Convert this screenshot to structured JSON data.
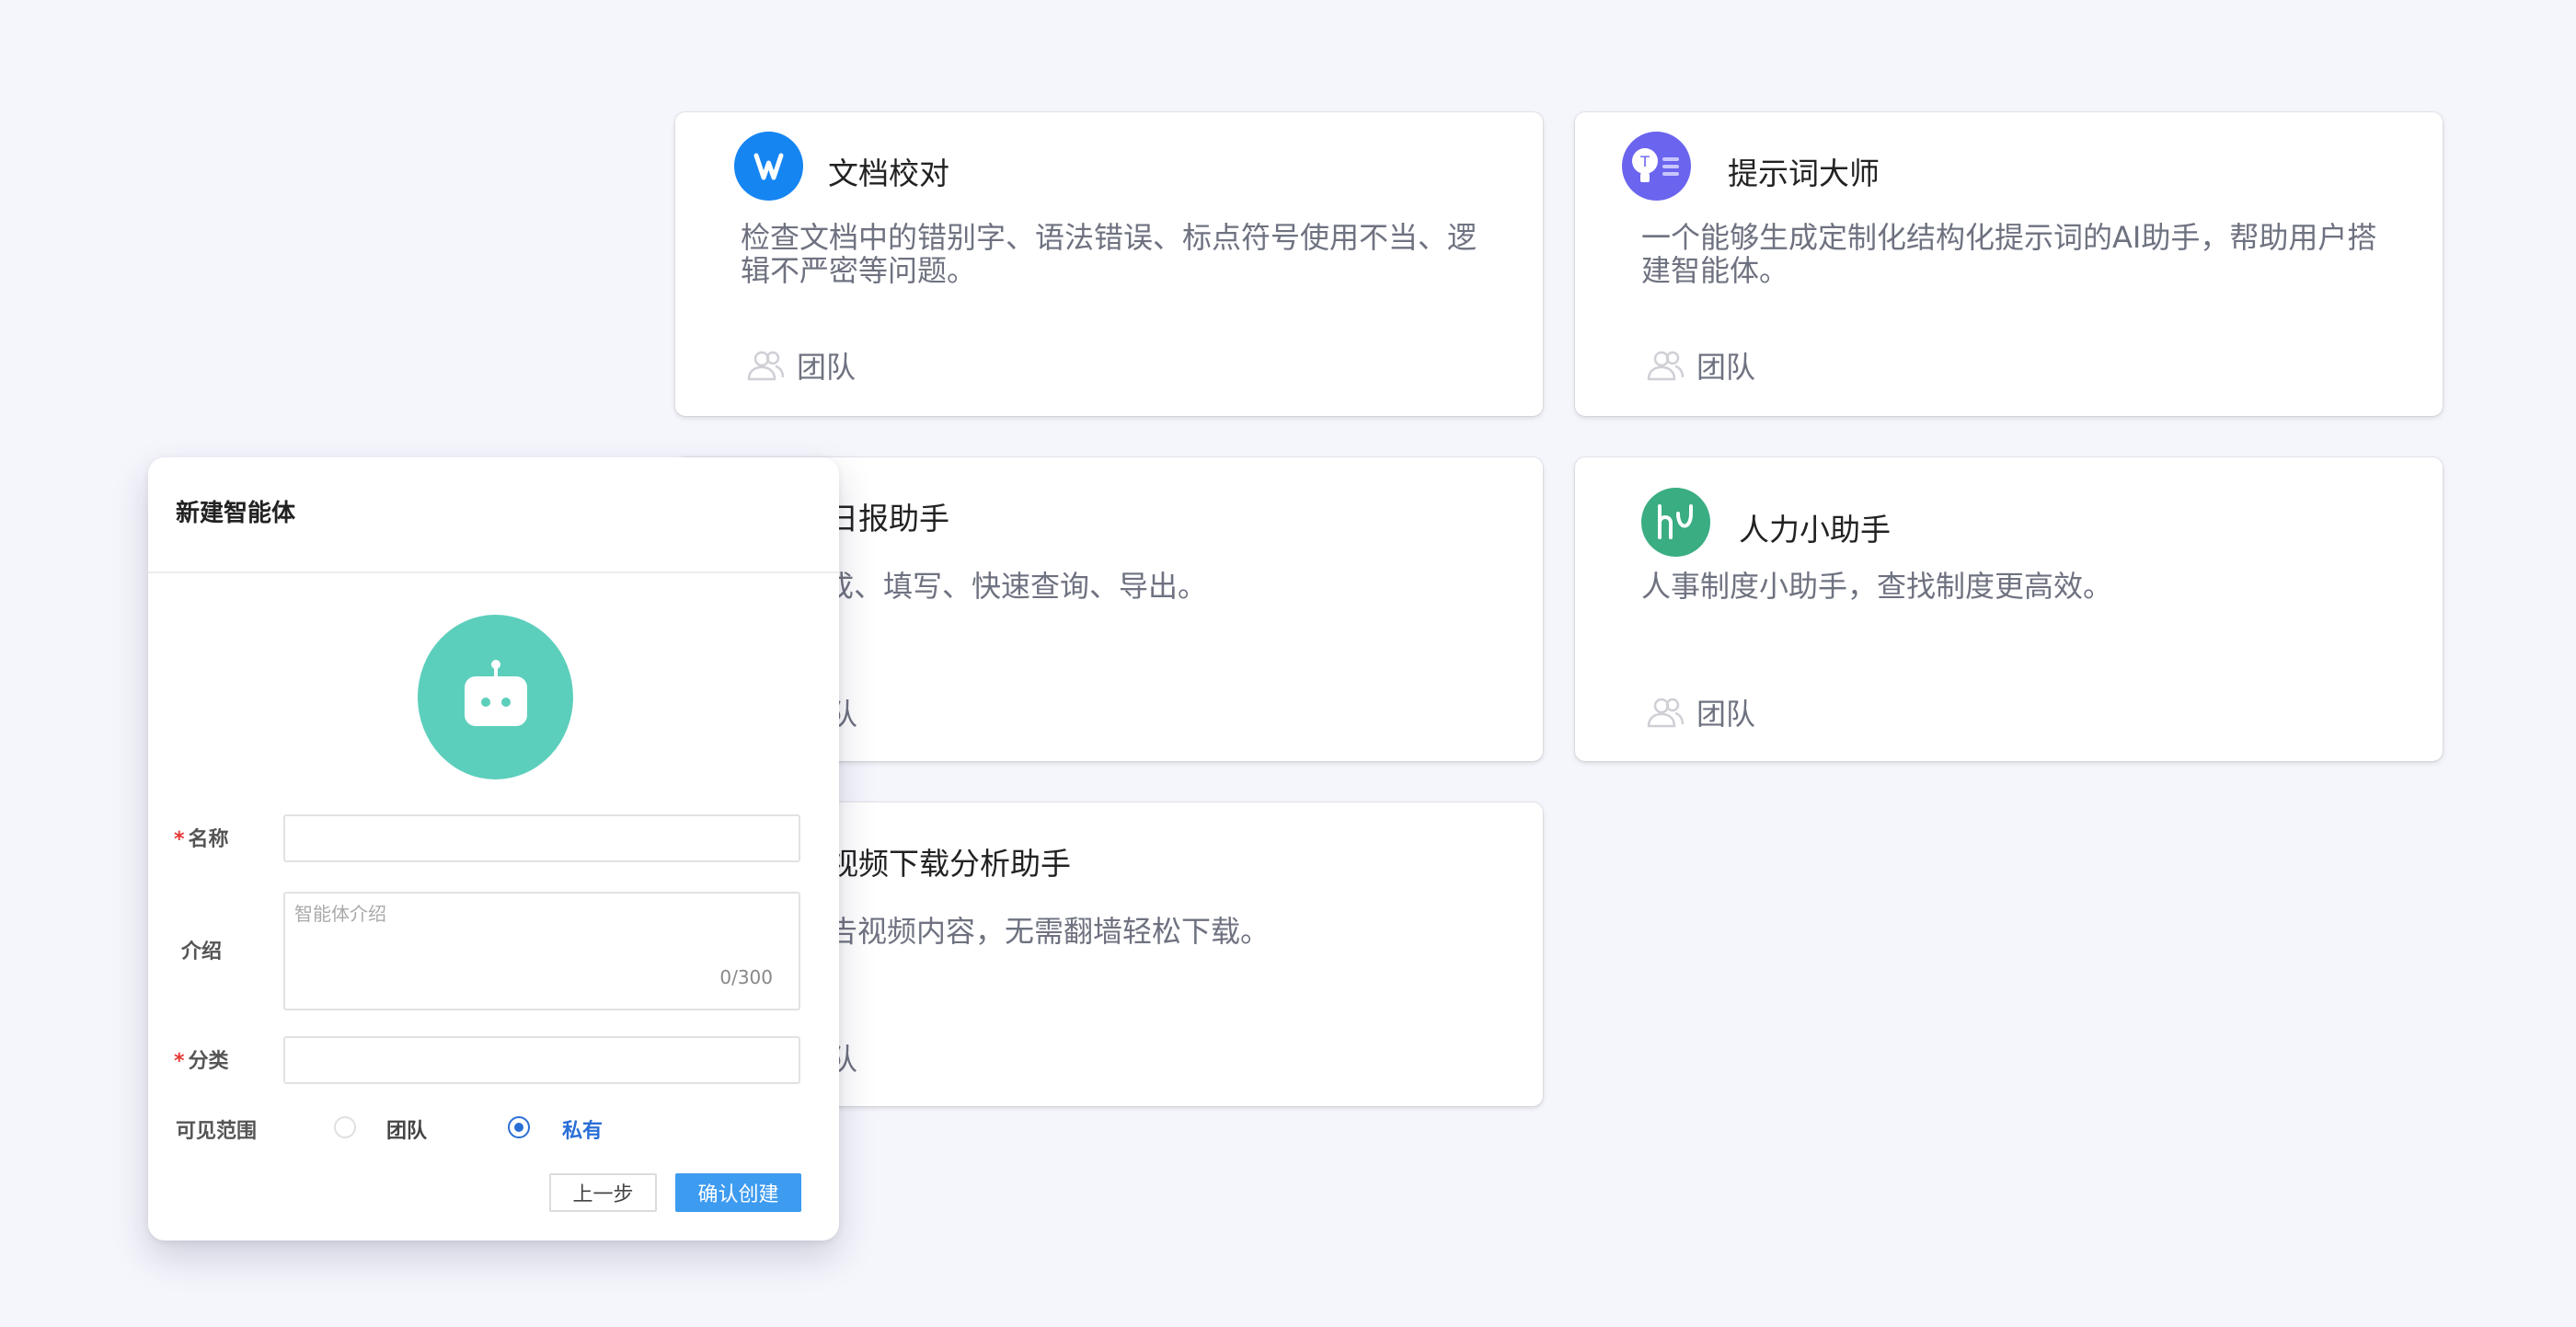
{
  "cards": [
    {
      "title": "文档校对",
      "desc": "检查文档中的错别字、语法错误、标点符号使用不当、逻辑不严密等问题。",
      "team": "团队",
      "icon": "document-w-icon",
      "color": "#1585f2"
    },
    {
      "title": "提示词大师",
      "desc": "一个能够生成定制化结构化提示词的AI助手，帮助用户搭建智能体。",
      "team": "团队",
      "icon": "lightbulb-icon",
      "color": "#6a64ee"
    },
    {
      "title": "日报助手",
      "desc": "成、填写、快速查询、导出。",
      "team": "队",
      "icon": "",
      "color": ""
    },
    {
      "title": "人力小助手",
      "desc": "人事制度小助手，查找制度更高效。",
      "team": "团队",
      "icon": "hr-logo-icon",
      "color": "#3aad82"
    },
    {
      "title": "视频下载分析助手",
      "desc": "告视频内容，无需翻墙轻松下载。",
      "team": "队",
      "icon": "",
      "color": ""
    }
  ],
  "modal": {
    "title": "新建智能体",
    "avatar_icon": "robot-icon",
    "avatar_color": "#5ccfbc",
    "name_label": "名称",
    "intro_label": "介绍",
    "intro_placeholder": "智能体介绍",
    "intro_counter": "0/300",
    "category_label": "分类",
    "visibility_label": "可见范围",
    "visibility_options": [
      {
        "label": "团队",
        "selected": false
      },
      {
        "label": "私有",
        "selected": true
      }
    ],
    "prev_button": "上一步",
    "confirm_button": "确认创建"
  }
}
